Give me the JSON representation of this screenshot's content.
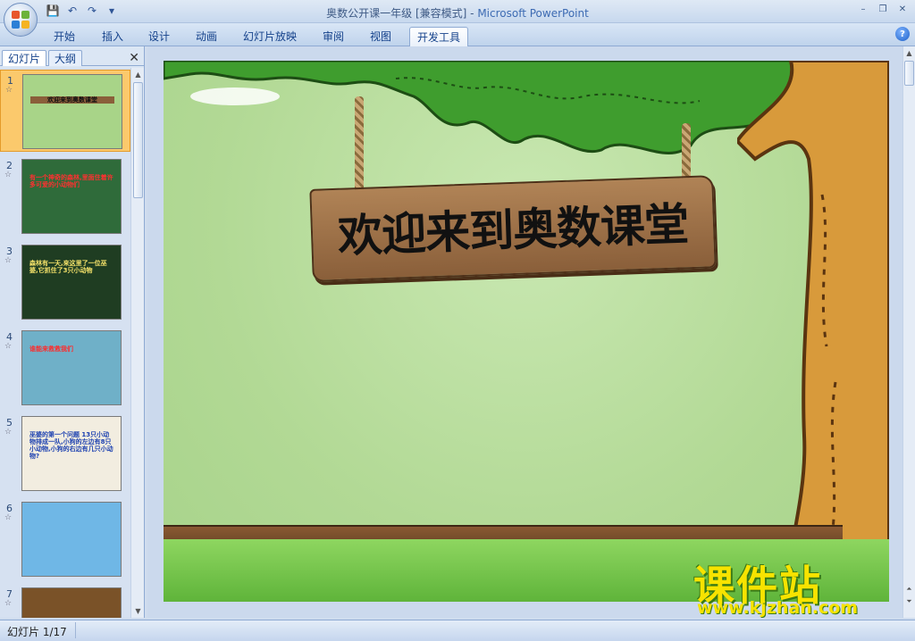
{
  "window": {
    "title": "奥数公开课一年级 [兼容模式] - ",
    "app_name": "Microsoft PowerPoint"
  },
  "ribbon": {
    "tabs": [
      "开始",
      "插入",
      "设计",
      "动画",
      "幻灯片放映",
      "审阅",
      "视图",
      "开发工具"
    ],
    "active_tab": "开发工具"
  },
  "left_pane": {
    "tabs": [
      "幻灯片",
      "大纲"
    ],
    "active_tab": "幻灯片",
    "thumbnails": [
      {
        "num": "1",
        "caption": "欢迎来到奥数课堂",
        "bg": "#a8d488",
        "fg": "#111",
        "selected": true
      },
      {
        "num": "2",
        "caption": "有一个神奇的森林,里面住着许多可爱的小动物们",
        "bg": "#2f6b3a",
        "fg": "#ff3030",
        "selected": false
      },
      {
        "num": "3",
        "caption": "森林有一天,来这里了一位巫婆,它抓住了3只小动物",
        "bg": "#1f3d22",
        "fg": "#f6e36a",
        "selected": false
      },
      {
        "num": "4",
        "caption": "谁能来救救我们",
        "bg": "#6fb0c8",
        "fg": "#ff2a2a",
        "selected": false
      },
      {
        "num": "5",
        "caption": "巫婆的第一个问题 13只小动物排成一队,小狗的左边有8只小动物,小狗的右边有几只小动物?",
        "bg": "#f2ede0",
        "fg": "#1a3fb0",
        "selected": false
      },
      {
        "num": "6",
        "caption": "",
        "bg": "#6fb7e6",
        "fg": "#c0392b",
        "selected": false
      },
      {
        "num": "7",
        "caption": "",
        "bg": "#7a5228",
        "fg": "#f4d23a",
        "selected": false
      }
    ]
  },
  "slide": {
    "title": "欢迎来到奥数课堂"
  },
  "status": {
    "slide_info": "幻灯片 1/17"
  },
  "watermark": {
    "big": "课件站",
    "url": "www.kjzhan.com"
  }
}
